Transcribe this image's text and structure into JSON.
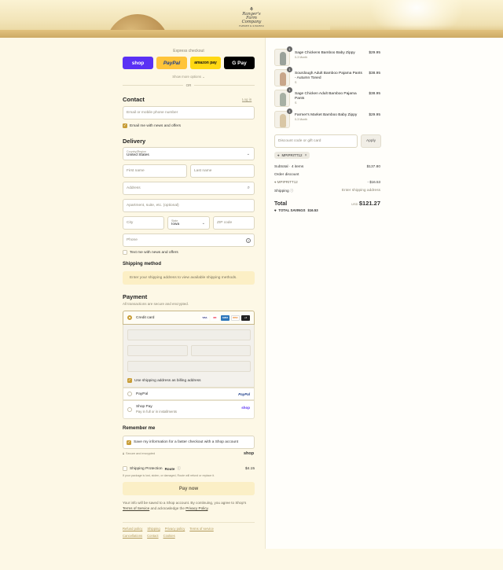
{
  "brand": {
    "logo_line1": "Ranger's",
    "logo_line2": "Farm Company",
    "logo_tag": "FARMER & KINDRED"
  },
  "express": {
    "label": "Express checkout",
    "buttons": [
      "shop",
      "PayPal",
      "amazon pay",
      "G Pay"
    ],
    "more": "Show more options ⌄",
    "or": "OR"
  },
  "contact": {
    "title": "Contact",
    "login": "Log in",
    "email_placeholder": "Email or mobile phone number",
    "news": "Email me with news and offers"
  },
  "delivery": {
    "title": "Delivery",
    "country_label": "Country/Region",
    "country": "United States",
    "first": "First name",
    "last": "Last name",
    "address": "Address",
    "apt": "Apartment, suite, etc. (optional)",
    "city": "City",
    "state_label": "State",
    "state": "Iowa",
    "zip": "ZIP code",
    "phone": "Phone",
    "text_me": "Text me with news and offers"
  },
  "shipping": {
    "title": "Shipping method",
    "notice": "Enter your shipping address to view available shipping methods."
  },
  "payment": {
    "title": "Payment",
    "subtitle": "All transactions are secure and encrypted.",
    "credit": "Credit card",
    "cards": [
      "VISA",
      "MC",
      "AMEX",
      "DISC",
      "+4"
    ],
    "billing": "Use shipping address as billing address",
    "paypal": "PayPal",
    "shoppay": "Shop Pay",
    "shoppay_sub": "Pay in full or in installments",
    "shop_brand": "shop"
  },
  "remember": {
    "title": "Remember me",
    "save": "Save my information for a faster checkout with a Shop account",
    "secure": "Secure and encrypted",
    "shop": "shop"
  },
  "protection": {
    "label": "Shipping Protection",
    "route": "Route",
    "price": "$4.15",
    "note": "If your package is lost, stolen, or damaged, Route will refund or replace it."
  },
  "pay": {
    "button": "Pay now",
    "legal_1": "Your info will be saved to a Shop account. By continuing, you agree to Shop's ",
    "tos": "Terms of Service",
    "legal_2": " and acknowledge the ",
    "privacy": "Privacy Policy",
    "legal_3": "."
  },
  "footer": {
    "row1": [
      "Refund policy",
      "Shipping",
      "Privacy policy",
      "Terms of service"
    ],
    "row2": [
      "Cancellations",
      "Contact",
      "Cookies"
    ]
  },
  "cart": {
    "items": [
      {
        "qty": "1",
        "name": "Sage Chickens Bamboo Baby Zippy",
        "sub": "0-3 Month",
        "price": "$29.95",
        "color": "#9aa29a"
      },
      {
        "qty": "1",
        "name": "Sourdough Adult Bamboo Pajama Pants - Autumn Toned",
        "sub": "S",
        "price": "$38.95",
        "color": "#c8a68a"
      },
      {
        "qty": "1",
        "name": "Sage Chicken Adult Bamboo Pajama Pants",
        "sub": "S",
        "price": "$38.95",
        "color": "#a7b0a3"
      },
      {
        "qty": "1",
        "name": "Farmer's Market Bamboo Baby Zippy",
        "sub": "0-3 Month",
        "price": "$29.95",
        "color": "#d9c7a5"
      }
    ],
    "discount_placeholder": "Discount code or gift card",
    "apply": "Apply",
    "code": "MPIPRITT12",
    "subtotal_label": "Subtotal · 4 items",
    "subtotal": "$137.80",
    "order_discount": "Order discount",
    "disc_code": "MPIPRITT12",
    "disc_amount": "- $16.53",
    "shipping_label": "Shipping",
    "shipping_value": "Enter shipping address",
    "total_label": "Total",
    "currency": "USD",
    "total": "$121.27",
    "savings_label": "TOTAL SAVINGS",
    "savings": "$16.53"
  }
}
